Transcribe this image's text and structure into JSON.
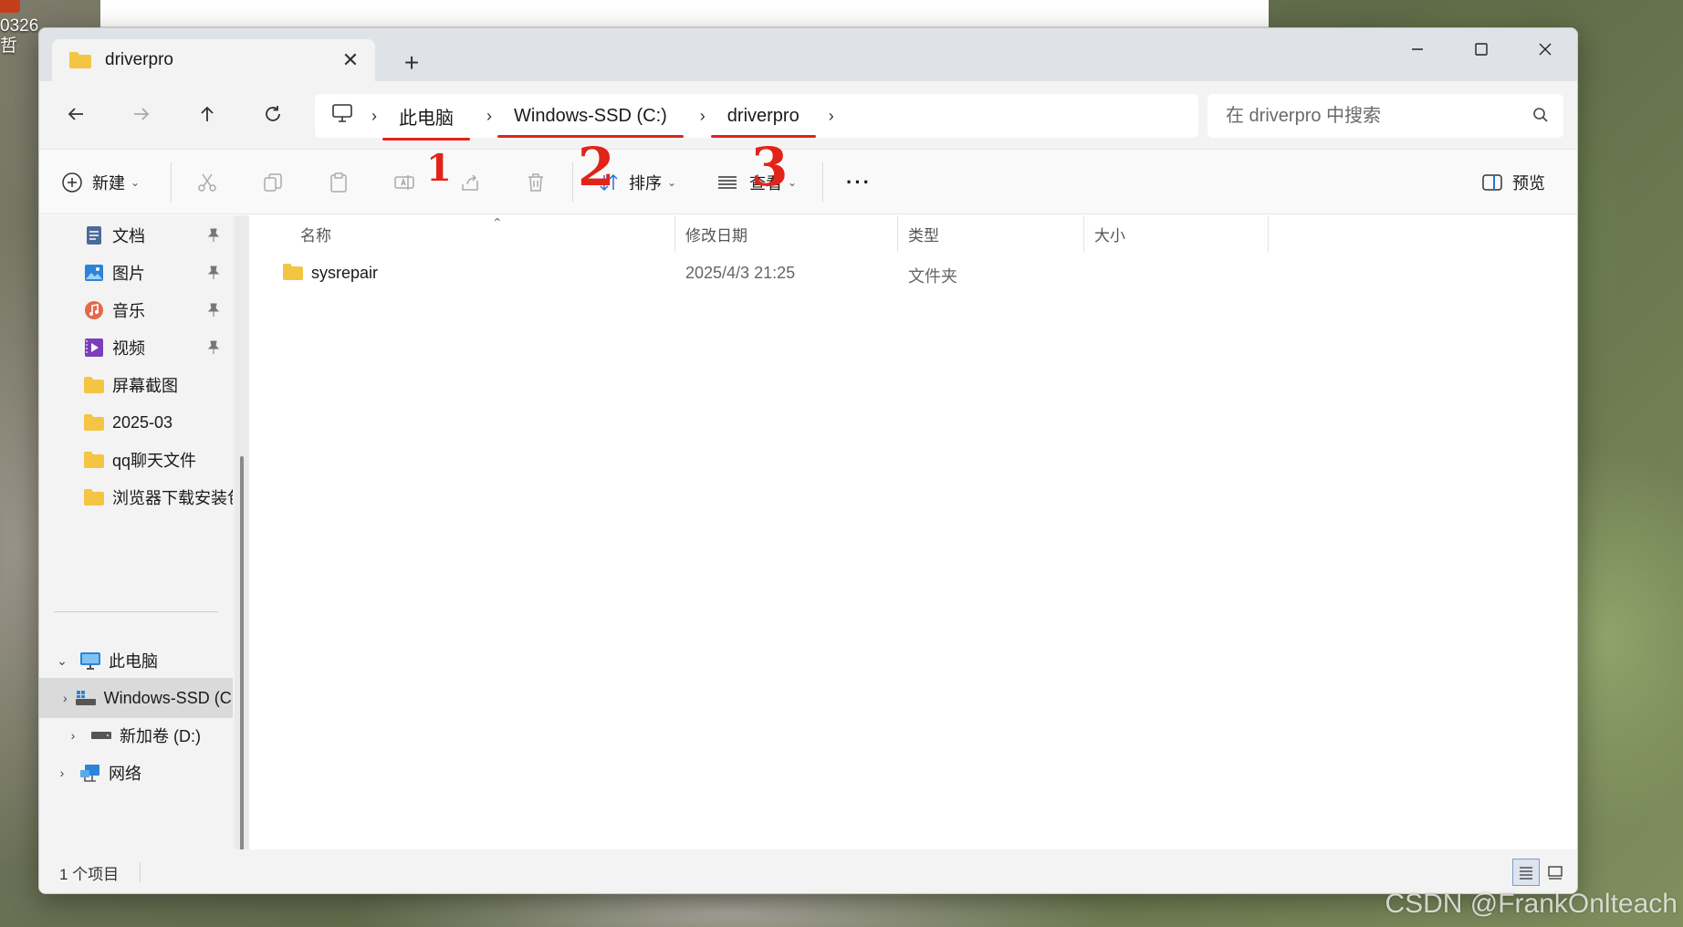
{
  "desktop": {
    "icon_text_1": "0326",
    "icon_text_2": "哲",
    "watermark": "CSDN @FrankOnlteach"
  },
  "tab": {
    "title": "driverpro"
  },
  "window_controls": {
    "minimize": "minimize",
    "maximize": "maximize",
    "close": "close"
  },
  "address": {
    "crumbs": [
      "此电脑",
      "Windows-SSD (C:)",
      "driverpro"
    ]
  },
  "search": {
    "placeholder": "在 driverpro 中搜索"
  },
  "toolbar": {
    "new_label": "新建",
    "sort_label": "排序",
    "view_label": "查看",
    "more_label": "···",
    "preview_label": "预览"
  },
  "sidebar": {
    "quick_access": [
      {
        "label": "文档",
        "icon": "document-icon",
        "pinned": true
      },
      {
        "label": "图片",
        "icon": "pictures-icon",
        "pinned": true
      },
      {
        "label": "音乐",
        "icon": "music-icon",
        "pinned": true
      },
      {
        "label": "视频",
        "icon": "videos-icon",
        "pinned": true
      },
      {
        "label": "屏幕截图",
        "icon": "folder-icon",
        "pinned": false
      },
      {
        "label": "2025-03",
        "icon": "folder-icon",
        "pinned": false
      },
      {
        "label": "qq聊天文件",
        "icon": "folder-icon",
        "pinned": false
      },
      {
        "label": "浏览器下载安装包",
        "icon": "folder-icon",
        "pinned": false
      }
    ],
    "this_pc": "此电脑",
    "drives": [
      {
        "label": "Windows-SSD (C:)",
        "selected": true
      },
      {
        "label": "新加卷 (D:)",
        "selected": false
      }
    ],
    "network": "网络"
  },
  "columns": {
    "name": "名称",
    "modified": "修改日期",
    "type": "类型",
    "size": "大小"
  },
  "files": [
    {
      "name": "sysrepair",
      "modified": "2025/4/3 21:25",
      "type": "文件夹",
      "size": ""
    }
  ],
  "status": {
    "item_count": "1 个项目"
  },
  "annotations": [
    "1",
    "2",
    "3"
  ],
  "colors": {
    "annotation": "#e2231a",
    "folder": "#f4c542",
    "accent": "#2b6fd6"
  }
}
